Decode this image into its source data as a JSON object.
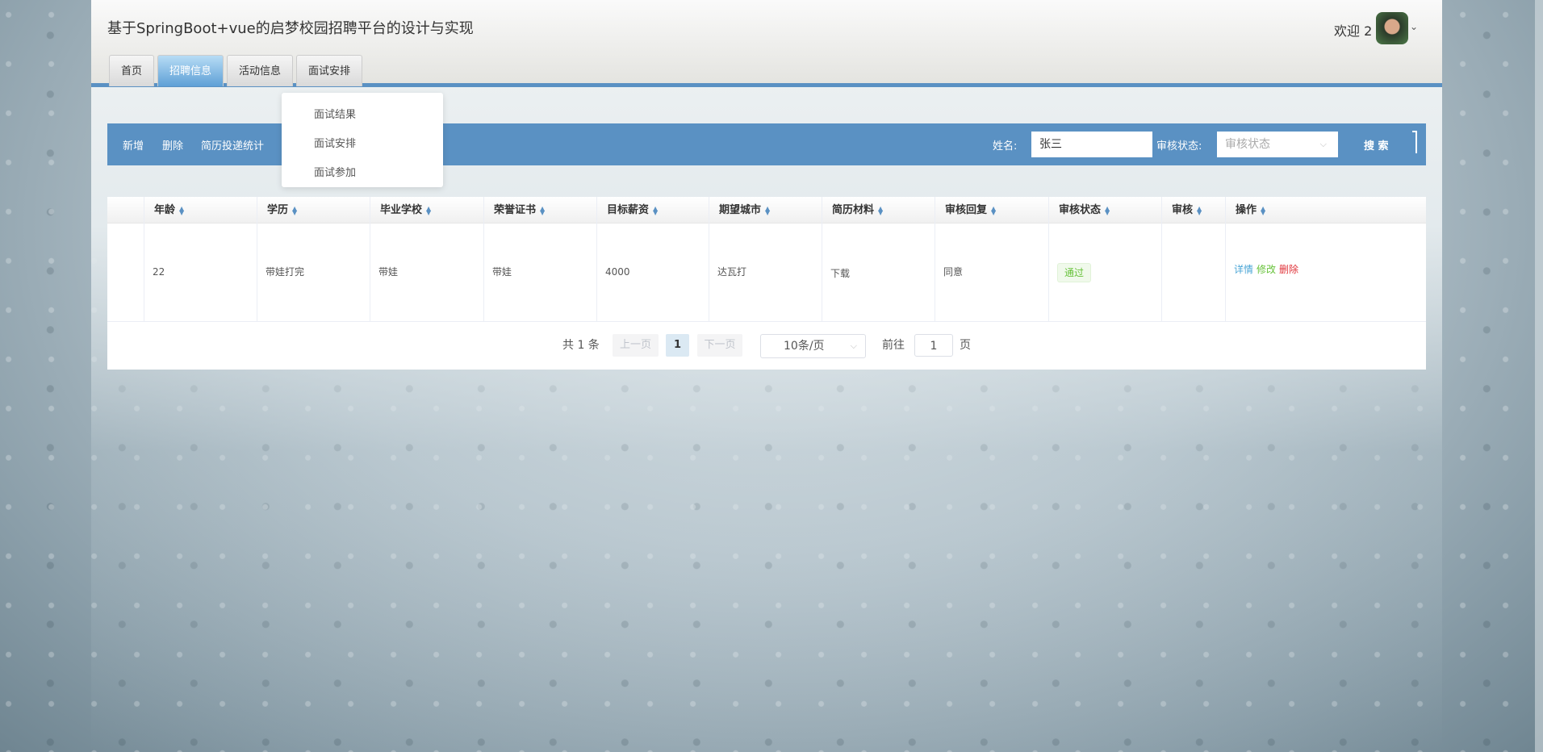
{
  "header": {
    "title": "基于SpringBoot+vue的启梦校园招聘平台的设计与实现",
    "welcome": "欢迎 2"
  },
  "tabs": [
    "首页",
    "招聘信息",
    "活动信息",
    "面试安排"
  ],
  "dropdown": [
    "面试结果",
    "面试安排",
    "面试参加"
  ],
  "toolbar": {
    "add": "新增",
    "delete": "删除",
    "stats": "简历投递统计",
    "name_label": "姓名:",
    "name_value": "张三",
    "status_label": "审核状态:",
    "status_placeholder": "审核状态",
    "search": "搜 索"
  },
  "table": {
    "headers": [
      "年龄",
      "学历",
      "毕业学校",
      "荣誉证书",
      "目标薪资",
      "期望城市",
      "简历材料",
      "审核回复",
      "审核状态",
      "审核",
      "操作"
    ],
    "rows": [
      {
        "age": "22",
        "edu": "带娃打完",
        "school": "带娃",
        "cert": "带娃",
        "salary": "4000",
        "city": "达瓦打",
        "resume": "下载",
        "reply": "同意",
        "status": "通过",
        "audit": "",
        "actions": [
          "详情",
          "修改",
          "删除"
        ]
      }
    ]
  },
  "pagination": {
    "total": "共 1 条",
    "prev": "上一页",
    "page": "1",
    "next": "下一页",
    "size": "10条/页",
    "goto": "前往",
    "goto_value": "1",
    "page_suffix": "页"
  },
  "colors": {
    "accent": "#5a91c3",
    "detail": "#4aa5d6",
    "edit": "#67c23a",
    "delete": "#e0343a"
  }
}
